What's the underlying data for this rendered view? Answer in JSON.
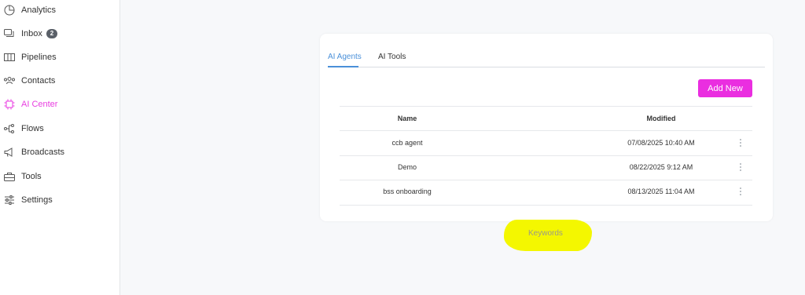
{
  "sidebar": {
    "items": [
      {
        "label": "Analytics",
        "icon": "analytics-icon"
      },
      {
        "label": "Inbox",
        "icon": "inbox-icon",
        "badge": "2"
      },
      {
        "label": "Pipelines",
        "icon": "pipelines-icon"
      },
      {
        "label": "Contacts",
        "icon": "contacts-icon"
      },
      {
        "label": "AI Center",
        "icon": "chip-icon",
        "active": true
      },
      {
        "label": "Flows",
        "icon": "flows-icon"
      },
      {
        "label": "Broadcasts",
        "icon": "megaphone-icon"
      },
      {
        "label": "Tools",
        "icon": "toolbox-icon"
      },
      {
        "label": "Settings",
        "icon": "sliders-icon"
      }
    ]
  },
  "main": {
    "tabs": [
      {
        "label": "AI Agents",
        "active": true
      },
      {
        "label": "AI Tools",
        "active": false
      }
    ],
    "add_button_label": "Add New",
    "table": {
      "headers": {
        "name": "Name",
        "modified": "Modified"
      },
      "rows": [
        {
          "name": "ccb agent",
          "modified": "07/08/2025 10:40 AM"
        },
        {
          "name": "Demo",
          "modified": "08/22/2025 9:12 AM"
        },
        {
          "name": "bss onboarding",
          "modified": "08/13/2025 11:04 AM"
        }
      ]
    },
    "keywords_link": "Keywords"
  },
  "colors": {
    "accent_pink": "#ea2ee0",
    "active_nav": "#e83ee0",
    "tab_blue": "#4a90d9",
    "highlight_yellow": "#f4f700"
  }
}
